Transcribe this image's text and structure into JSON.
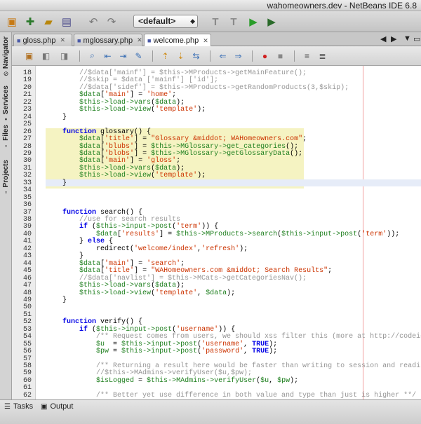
{
  "window": {
    "title": "wahomeowners.dev - NetBeans IDE 6.8"
  },
  "toolbar": {
    "config_combo": "<default>",
    "icons": [
      "new-project-icon",
      "new-file-icon",
      "open-project-icon",
      "save-all-icon",
      "undo-icon",
      "redo-icon",
      "build-icon",
      "clean-build-icon",
      "run-icon",
      "debug-icon"
    ]
  },
  "sidebar": {
    "tabs": [
      {
        "label": "Navigator"
      },
      {
        "label": "Services"
      },
      {
        "label": "Files"
      },
      {
        "label": "Projects"
      }
    ]
  },
  "editor_tabs": [
    {
      "label": "gloss.php"
    },
    {
      "label": "mglossary.php"
    },
    {
      "label": "welcome.php"
    }
  ],
  "active_tab": "welcome.php",
  "editor": {
    "lines": [
      {
        "n": "18",
        "text": "        //$data['mainf'] = $this->MProducts->getMainFeature();"
      },
      {
        "n": "19",
        "text": "        //$skip = $data ['mainf'] ['id'];"
      },
      {
        "n": "20",
        "text": "        //$data['sidef'] = $this->MProducts->getRandomProducts(3,$skip);"
      },
      {
        "n": "21",
        "text": "        $data['main'] = 'home';"
      },
      {
        "n": "22",
        "text": "        $this->load->vars($data);"
      },
      {
        "n": "23",
        "text": "        $this->load->view('template');"
      },
      {
        "n": "24",
        "text": "    }"
      },
      {
        "n": "25",
        "text": ""
      },
      {
        "n": "26",
        "text": "    function glossary() {"
      },
      {
        "n": "27",
        "text": "        $data['title'] = \"Glossary &middot; WAHomeowners.com\";"
      },
      {
        "n": "28",
        "text": "        $data['blubs'] = $this->MGlossary->get_categories();"
      },
      {
        "n": "29",
        "text": "        $data['blobs'] = $this->MGlossary->getGlossaryData();"
      },
      {
        "n": "30",
        "text": "        $data['main'] = 'gloss';"
      },
      {
        "n": "31",
        "text": "        $this->load->vars($data);"
      },
      {
        "n": "32",
        "text": "        $this->load->view('template');"
      },
      {
        "n": "33",
        "text": "    }"
      },
      {
        "n": "34",
        "text": ""
      },
      {
        "n": "35",
        "text": ""
      },
      {
        "n": "36",
        "text": ""
      },
      {
        "n": "37",
        "text": "    function search() {"
      },
      {
        "n": "38",
        "text": "        //use for search results"
      },
      {
        "n": "39",
        "text": "        if ($this->input->post('term')) {"
      },
      {
        "n": "40",
        "text": "            $data['results'] = $this->MProducts->search($this->input->post('term'));"
      },
      {
        "n": "41",
        "text": "        } else {"
      },
      {
        "n": "42",
        "text": "            redirect('welcome/index','refresh');"
      },
      {
        "n": "43",
        "text": "        }"
      },
      {
        "n": "44",
        "text": "        $data['main'] = 'search';"
      },
      {
        "n": "45",
        "text": "        $data['title'] = \"WAHomeowners.com &middot; Search Results\";"
      },
      {
        "n": "46",
        "text": "        //$data['navlist'] = $this->MCats->getCategoriesNav();"
      },
      {
        "n": "47",
        "text": "        $this->load->vars($data);"
      },
      {
        "n": "48",
        "text": "        $this->load->view('template', $data);"
      },
      {
        "n": "49",
        "text": "    }"
      },
      {
        "n": "50",
        "text": ""
      },
      {
        "n": "51",
        "text": ""
      },
      {
        "n": "52",
        "text": "    function verify() {"
      },
      {
        "n": "53",
        "text": "        if ($this->input->post('username')) {"
      },
      {
        "n": "54",
        "text": "            /** Request comes from users, we should xss filter this (more at http://codeigni"
      },
      {
        "n": "55",
        "text": "            $u  = $this->input->post('username', TRUE);"
      },
      {
        "n": "56",
        "text": "            $pw = $this->input->post('password', TRUE);"
      },
      {
        "n": "57",
        "text": ""
      },
      {
        "n": "58",
        "text": "            /** Returning a result here would be faster than writing to session and reading"
      },
      {
        "n": "59",
        "text": "            //$this->MAdmins->verifyUser($u,$pw);"
      },
      {
        "n": "60",
        "text": "            $isLogged = $this->MAdmins->verifyUser($u, $pw);"
      },
      {
        "n": "61",
        "text": ""
      },
      {
        "n": "62",
        "text": "            /** Better yet use difference in both value and type than just is higher **/"
      }
    ]
  },
  "bottom_tabs": [
    {
      "label": "Tasks"
    },
    {
      "label": "Output"
    }
  ],
  "colors": {
    "keyword": "#0000e6",
    "variable": "#1e7f1e",
    "string": "#cc3300",
    "comment": "#969696",
    "highlight": "#f5f3c2"
  }
}
